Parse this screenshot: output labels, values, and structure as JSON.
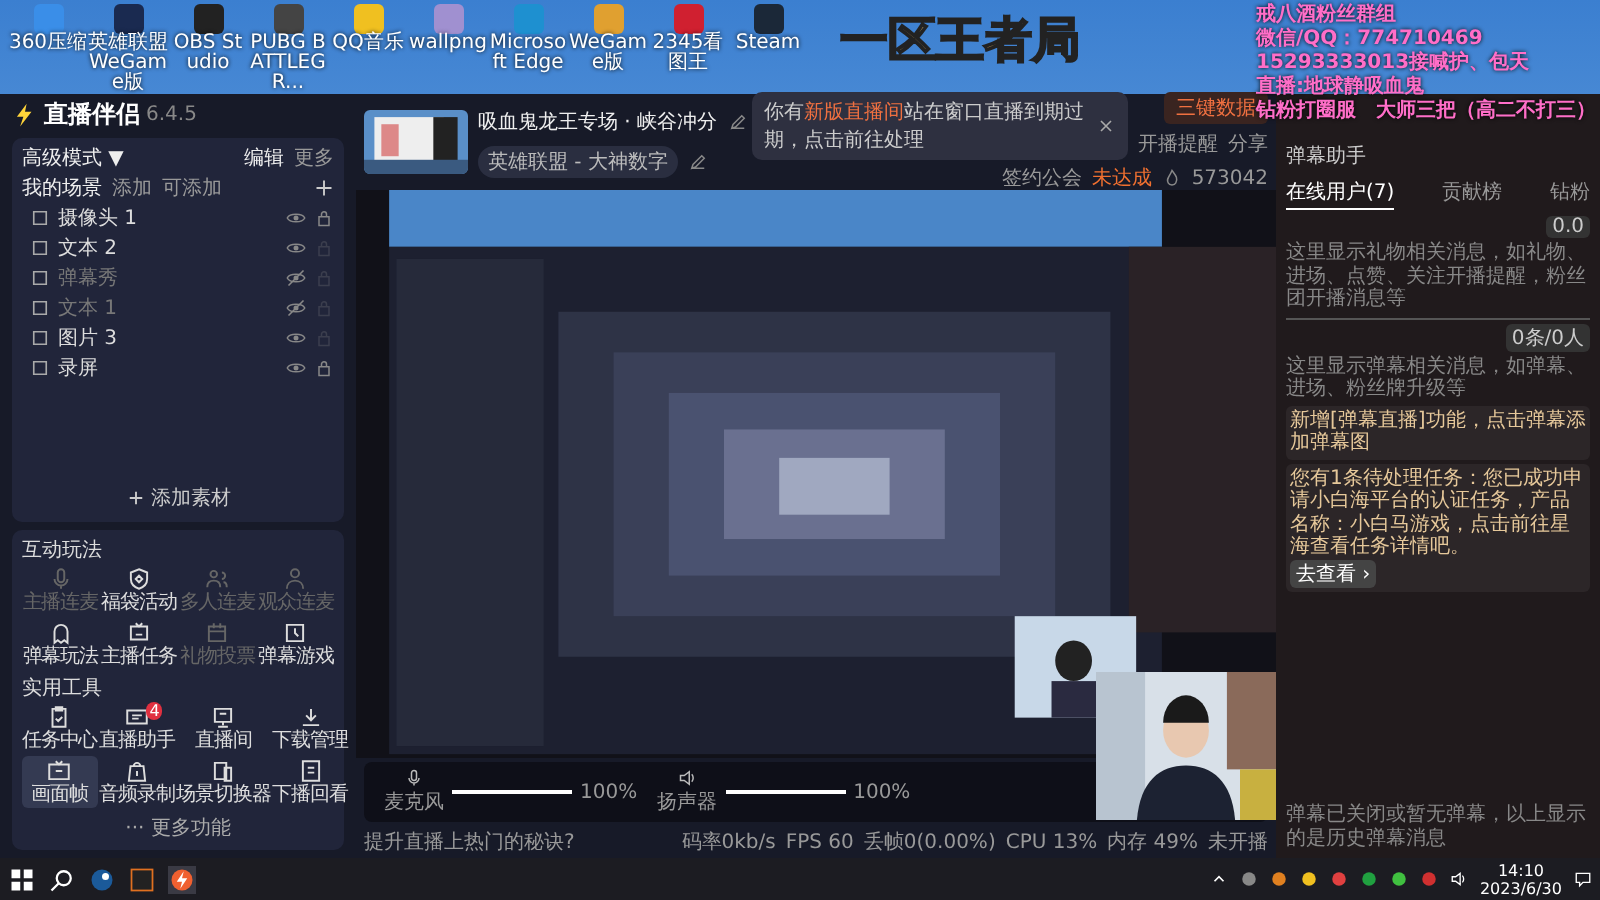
{
  "desktop_icons": [
    {
      "label": "360压缩"
    },
    {
      "label": "英雄联盟WeGame版"
    },
    {
      "label": "OBS Studio"
    },
    {
      "label": "PUBG BATTLEGR..."
    },
    {
      "label": "QQ音乐"
    },
    {
      "label": "wallpng"
    },
    {
      "label": "Microsoft Edge"
    },
    {
      "label": "WeGame版"
    },
    {
      "label": "2345看图王"
    },
    {
      "label": "Steam"
    }
  ],
  "overlay_title": "一区王者局",
  "fan_overlay": [
    "戒八酒粉丝群组",
    "微信/QQ：774710469",
    "15293333013接喊护、包天",
    "直播:地球静吸血鬼",
    "钻粉打圈服　大师三把（高二不打三）"
  ],
  "app": {
    "name": "直播伴侣",
    "version": "6.4.5"
  },
  "scenes": {
    "mode": "高级模式 ▼",
    "edit": "编辑",
    "more": "更多",
    "section": "我的场景",
    "add_scene": "添加",
    "addable": "可添加",
    "add_source": "添加素材",
    "sources": [
      {
        "name": "摄像头 1",
        "visible": true,
        "locked": true
      },
      {
        "name": "文本 2",
        "visible": true,
        "locked": false
      },
      {
        "name": "弹幕秀",
        "visible": false,
        "locked": false
      },
      {
        "name": "文本 1",
        "visible": false,
        "locked": false
      },
      {
        "name": "图片 3",
        "visible": true,
        "locked": false
      },
      {
        "name": "录屏",
        "visible": true,
        "locked": true
      }
    ]
  },
  "interaction": {
    "title": "互动玩法",
    "items": [
      {
        "label": "主播连麦",
        "disabled": true
      },
      {
        "label": "福袋活动",
        "disabled": false
      },
      {
        "label": "多人连麦",
        "disabled": true
      },
      {
        "label": "观众连麦",
        "disabled": true
      },
      {
        "label": "弹幕玩法",
        "disabled": false
      },
      {
        "label": "主播任务",
        "disabled": false
      },
      {
        "label": "礼物投票",
        "disabled": true
      },
      {
        "label": "弹幕游戏",
        "disabled": false
      }
    ]
  },
  "tools": {
    "title": "实用工具",
    "items": [
      {
        "label": "任务中心"
      },
      {
        "label": "直播助手",
        "badge": "4"
      },
      {
        "label": "直播间"
      },
      {
        "label": "下载管理"
      },
      {
        "label": "画面帧",
        "selected": true
      },
      {
        "label": "音频录制"
      },
      {
        "label": "场景切换器"
      },
      {
        "label": "下播回看"
      }
    ],
    "more": "··· 更多功能"
  },
  "stream": {
    "title": "吸血鬼龙王专场 · 峡谷冲分",
    "category": "英雄联盟 - 大神数字"
  },
  "toast": {
    "before": "你有",
    "highlight": "新版直播间",
    "after": "站在窗口直播到期过期，点击前往处理"
  },
  "toolbar": {
    "data_button": "三键数据",
    "remind": "开播提醒",
    "share": "分享",
    "guild": "签约公会",
    "guild_status": "未达成",
    "heat": "573042"
  },
  "audio": [
    {
      "label": "麦克风",
      "level": 1,
      "reading": "100%"
    },
    {
      "label": "扬声器",
      "level": 1,
      "reading": "100%"
    }
  ],
  "status_bar": {
    "tip": "提升直播上热门的秘诀?",
    "stats": [
      "码率0kb/s",
      "FPS 60",
      "丢帧0(0.00%)",
      "CPU 13%",
      "内存 49%",
      "未开播"
    ]
  },
  "danmu": {
    "title": "弹幕助手",
    "tabs": [
      {
        "label": "在线用户(7)",
        "selected": true
      },
      {
        "label": "贡献榜",
        "selected": false
      },
      {
        "label": "钻粉",
        "selected": false
      }
    ],
    "score": "0.0",
    "gift_note": "这里显示礼物相关消息，如礼物、进场、点赞、关注开播提醒，粉丝团开播消息等",
    "count": "0条/0人",
    "danmu_note": "这里显示弹幕相关消息，如弹幕、进场、粉丝牌升级等",
    "notices": [
      "新增[弹幕直播]功能，点击弹幕添加弹幕图",
      "您有1条待处理任务：您已成功申请小白海平台的认证任务，产品名称：小白马游戏，点击前往星海查看任务详情吧。"
    ],
    "notice_button": "去查看 ›",
    "footer": "弹幕已关闭或暂无弹幕，以上显示的是历史弹幕消息"
  },
  "taskbar": {
    "time": "14:10",
    "date": "2023/6/30"
  }
}
